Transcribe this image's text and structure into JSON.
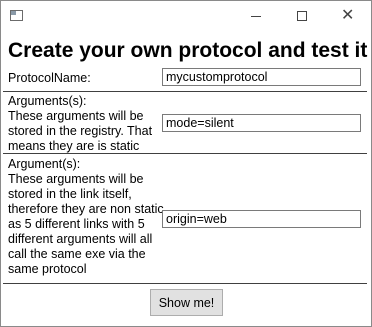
{
  "window": {
    "icon": "app-icon",
    "controls": {
      "minimize": "minimize-icon",
      "maximize": "maximize-icon",
      "close": "close-icon"
    }
  },
  "heading": "Create your own protocol and test it",
  "protocol_name": {
    "label": "ProtocolName:",
    "value": "mycustomprotocol"
  },
  "static_args": {
    "label": "Arguments(s):\nThese arguments will be\nstored in the registry. That\nmeans they are is static",
    "value": "mode=silent"
  },
  "link_args": {
    "label": "Argument(s):\nThese arguments will be\nstored in the link itself,\ntherefore they are non static\nas 5 different links with 5\ndifferent arguments will all\ncall the same exe via the\nsame protocol",
    "value": "origin=web"
  },
  "show_button": "Show me!"
}
